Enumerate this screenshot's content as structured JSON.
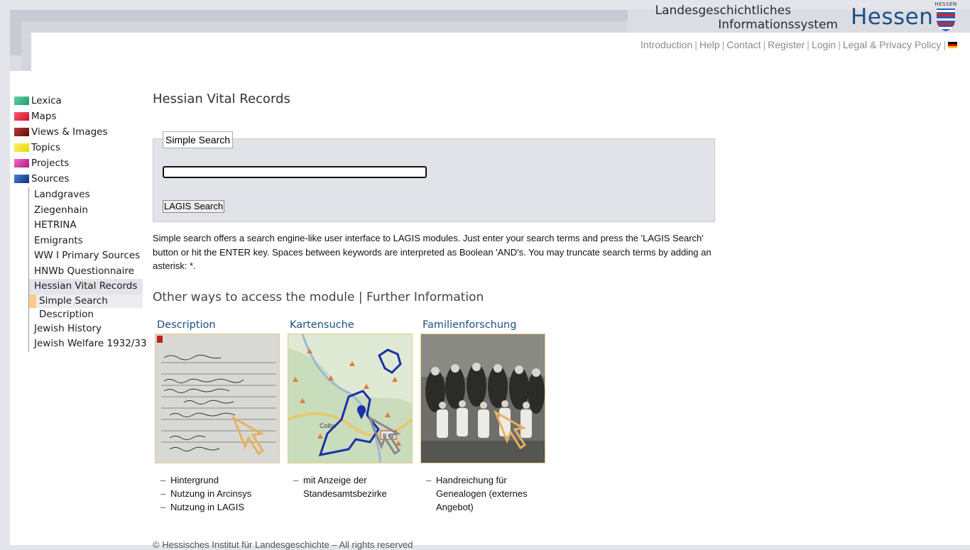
{
  "header": {
    "title_line1": "Landesgeschichtliches",
    "title_line2": "Informationssystem",
    "brand": "Hessen",
    "crest_label": "HESSEN",
    "nav": [
      "Introduction",
      "Help",
      "Contact",
      "Register",
      "Login",
      "Legal & Privacy Policy"
    ],
    "language_flag": "de-flag-icon"
  },
  "sidebar": {
    "top_items": [
      {
        "label": "Lexica",
        "color": "#2fb381"
      },
      {
        "label": "Maps",
        "color": "#e8213a"
      },
      {
        "label": "Views & Images",
        "color": "#8a1a1a"
      },
      {
        "label": "Topics",
        "color": "#f2e21a"
      },
      {
        "label": "Projects",
        "color": "#d936a8"
      },
      {
        "label": "Sources",
        "color": "#1d4fa8"
      }
    ],
    "sources_children": [
      "Landgraves",
      "Ziegenhain",
      "HETRINA",
      "Emigrants",
      "WW I Primary Sources",
      "HNWb Questionnaire",
      "Hessian Vital Records"
    ],
    "vital_records_children": [
      "Simple Search",
      "Description"
    ],
    "sources_children_after": [
      "Jewish History",
      "Jewish Welfare 1932/33"
    ]
  },
  "main": {
    "title": "Hessian Vital Records",
    "legend": "Simple Search",
    "search_value": "",
    "search_button": "LAGIS Search",
    "help_text": "Simple search offers a search engine-like user interface to LAGIS modules. Just enter your search terms and press the 'LAGIS Search' button or hit the ENTER key. Spaces between keywords are interpreted as Boolean 'AND's. You may truncate search terms by adding an asterisk: *.",
    "section_title": "Other ways to access the module | Further Information",
    "cards": [
      {
        "title": "Description",
        "items": [
          "Hintergrund",
          "Nutzung in Arcinsys",
          "Nutzung in LAGIS"
        ]
      },
      {
        "title": "Kartensuche",
        "items": [
          "mit Anzeige der Standesamtsbezirke"
        ],
        "map_labels": [
          "Colbe",
          "B 62"
        ]
      },
      {
        "title": "Familienforschung",
        "items": [
          "Handreichung für Genealogen (externes Angebot)"
        ]
      }
    ]
  },
  "footer": {
    "text": "© Hessisches Institut für Landesgeschichte – All rights reserved"
  },
  "colors": {
    "accent": "#1d4f87",
    "active_marker": "#ffcc88"
  }
}
